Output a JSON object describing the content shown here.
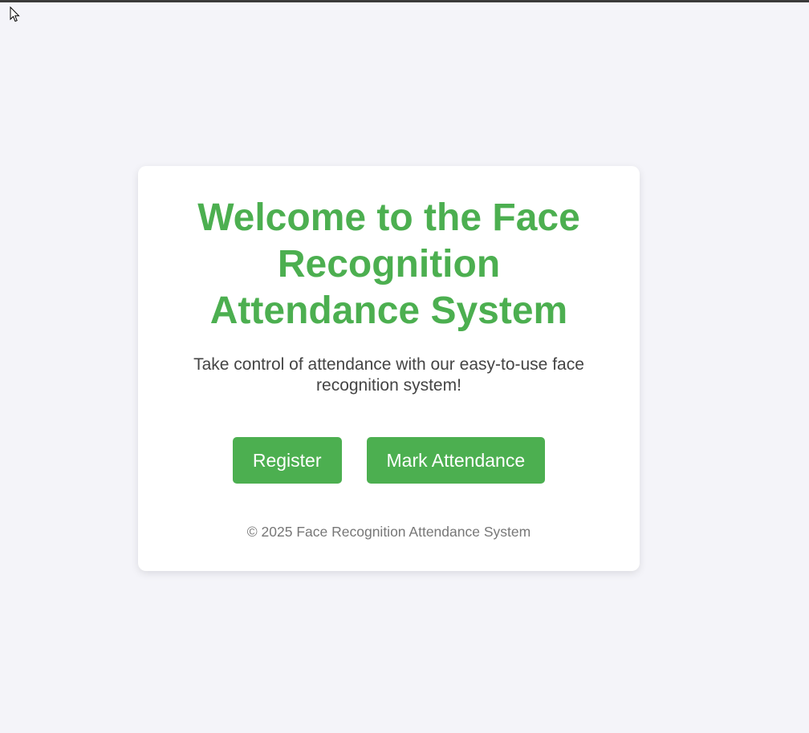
{
  "colors": {
    "background": "#f4f4f9",
    "card": "#ffffff",
    "accent": "#4caf50",
    "subtitle_text": "#444444",
    "footer_text": "#777777"
  },
  "card": {
    "title": "Welcome to the Face Recognition Attendance System",
    "subtitle": "Take control of attendance with our easy-to-use face recognition system!",
    "buttons": {
      "register_label": "Register",
      "mark_attendance_label": "Mark Attendance"
    },
    "footer": "© 2025 Face Recognition Attendance System"
  },
  "icons": {
    "cursor": "mouse-pointer-icon"
  }
}
